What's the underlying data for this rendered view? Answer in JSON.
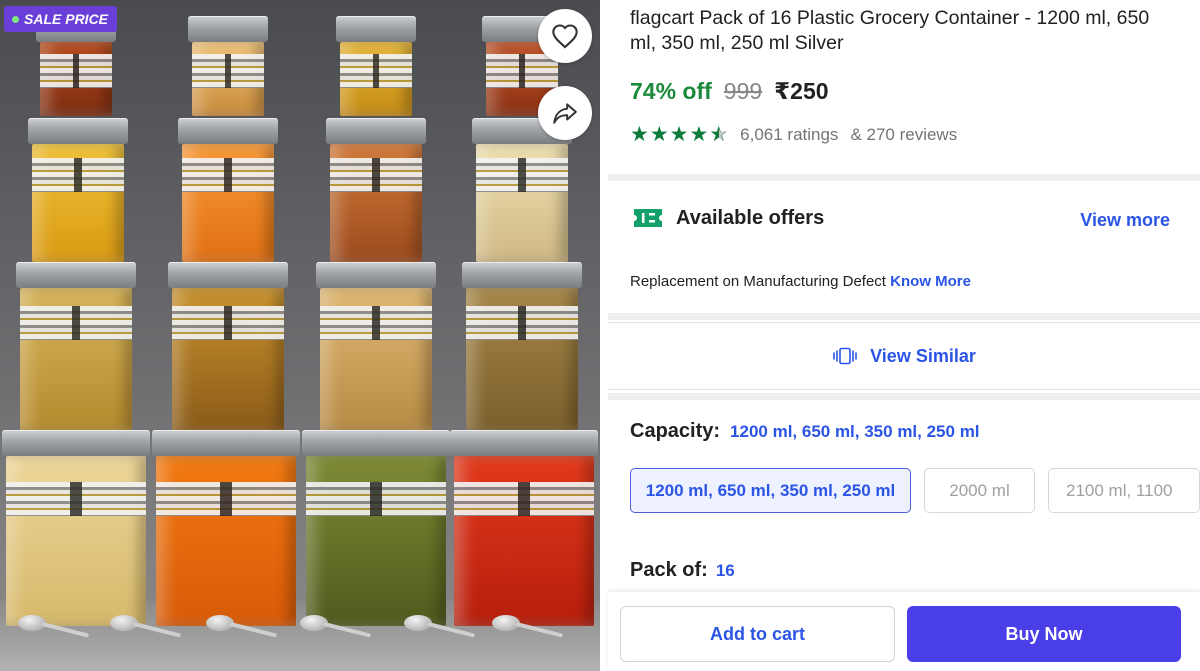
{
  "image": {
    "badge": "SALE PRICE",
    "icons": [
      "heart-icon",
      "share-icon"
    ],
    "contents_colors": [
      "#e8c968",
      "#e86a10",
      "#6a7a2a",
      "#d9341c"
    ]
  },
  "product": {
    "title": "flagcart Pack of 16 Plastic Grocery Container  - 1200 ml, 650 ml, 350 ml, 250 ml Silver",
    "discount": "74% off",
    "mrp": "999",
    "price": "₹250",
    "rating": 4.3,
    "ratings_text": "6,061 ratings",
    "reviews_text": "& 270 reviews"
  },
  "offers": {
    "title": "Available offers",
    "view_more": "View more",
    "replacement_text": "Replacement on Manufacturing Defect",
    "know_more": "Know More",
    "icon": "offer-ticket-icon"
  },
  "view_similar": {
    "label": "View Similar",
    "icon": "similar-cards-icon"
  },
  "capacity": {
    "label": "Capacity:",
    "selected": "1200 ml, 650 ml, 350 ml, 250 ml",
    "options": [
      "1200 ml, 650 ml, 350 ml, 250 ml",
      "2000 ml",
      "2100 ml, 1100"
    ]
  },
  "pack": {
    "label": "Pack of:",
    "value": "16"
  },
  "actions": {
    "add_to_cart": "Add to cart",
    "buy_now": "Buy Now"
  },
  "colors": {
    "accent_blue": "#2a55e5",
    "discount_green": "#1b8a3a",
    "star_green": "#0c7a3a",
    "buy_now_bg": "#4a3ee8",
    "sale_badge_bg": "#6a3fd8"
  }
}
